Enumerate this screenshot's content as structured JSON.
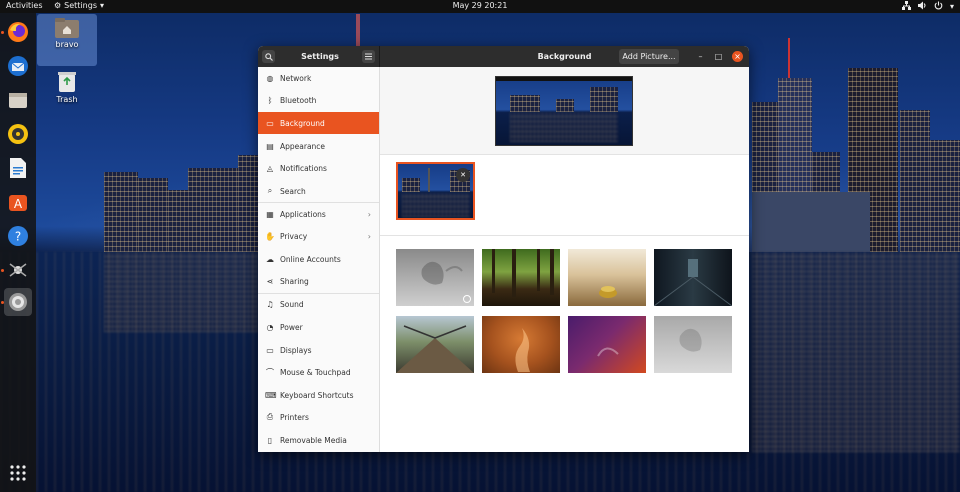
{
  "topbar": {
    "activities": "Activities",
    "app_menu": "Settings",
    "clock": "May 29  20:21",
    "tray_icons": [
      "network-icon",
      "volume-icon",
      "power-icon",
      "chevron-down-icon"
    ]
  },
  "dock": {
    "items": [
      {
        "name": "firefox-icon",
        "running": true
      },
      {
        "name": "thunderbird-icon",
        "running": false
      },
      {
        "name": "files-icon",
        "running": false
      },
      {
        "name": "rhythmbox-icon",
        "running": false
      },
      {
        "name": "writer-icon",
        "running": false
      },
      {
        "name": "software-icon",
        "running": false
      },
      {
        "name": "help-icon",
        "running": false
      },
      {
        "name": "screenshot-icon",
        "running": true
      },
      {
        "name": "settings-icon",
        "running": true,
        "active": true
      }
    ],
    "show_apps": "apps-grid-icon"
  },
  "desktop": {
    "icons": [
      {
        "label": "bravo",
        "icon": "home-folder-icon"
      },
      {
        "label": "Trash",
        "icon": "trash-icon"
      }
    ]
  },
  "window": {
    "sidebar_title": "Settings",
    "title": "Background",
    "add_picture": "Add Picture...",
    "controls": {
      "minimize": "–",
      "maximize": "□",
      "close": "×"
    },
    "sidebar": [
      {
        "label": "Network",
        "icon": "globe-icon"
      },
      {
        "label": "Bluetooth",
        "icon": "bluetooth-icon"
      },
      {
        "label": "Background",
        "icon": "monitor-icon",
        "active": true
      },
      {
        "label": "Appearance",
        "icon": "appearance-icon"
      },
      {
        "label": "Notifications",
        "icon": "bell-icon"
      },
      {
        "label": "Search",
        "icon": "search-icon"
      },
      {
        "label": "Applications",
        "icon": "grid-icon",
        "chevron": true
      },
      {
        "label": "Privacy",
        "icon": "hand-icon",
        "chevron": true
      },
      {
        "label": "Online Accounts",
        "icon": "cloud-icon"
      },
      {
        "label": "Sharing",
        "icon": "share-icon"
      },
      {
        "label": "Sound",
        "icon": "music-note-icon"
      },
      {
        "label": "Power",
        "icon": "power-icon"
      },
      {
        "label": "Displays",
        "icon": "display-icon"
      },
      {
        "label": "Mouse & Touchpad",
        "icon": "mouse-icon"
      },
      {
        "label": "Keyboard Shortcuts",
        "icon": "keyboard-icon"
      },
      {
        "label": "Printers",
        "icon": "printer-icon"
      },
      {
        "label": "Removable Media",
        "icon": "usb-icon"
      }
    ],
    "wallpapers": [
      {
        "name": "grey-cat",
        "timed": true
      },
      {
        "name": "forest"
      },
      {
        "name": "table-bokeh"
      },
      {
        "name": "dark-corridor"
      },
      {
        "name": "suspension-bridge"
      },
      {
        "name": "orange-flame"
      },
      {
        "name": "purple-gradient"
      },
      {
        "name": "grey-light"
      }
    ]
  },
  "colors": {
    "accent": "#e95420",
    "headerbar": "#2d2d2d",
    "topbar": "#111111"
  }
}
